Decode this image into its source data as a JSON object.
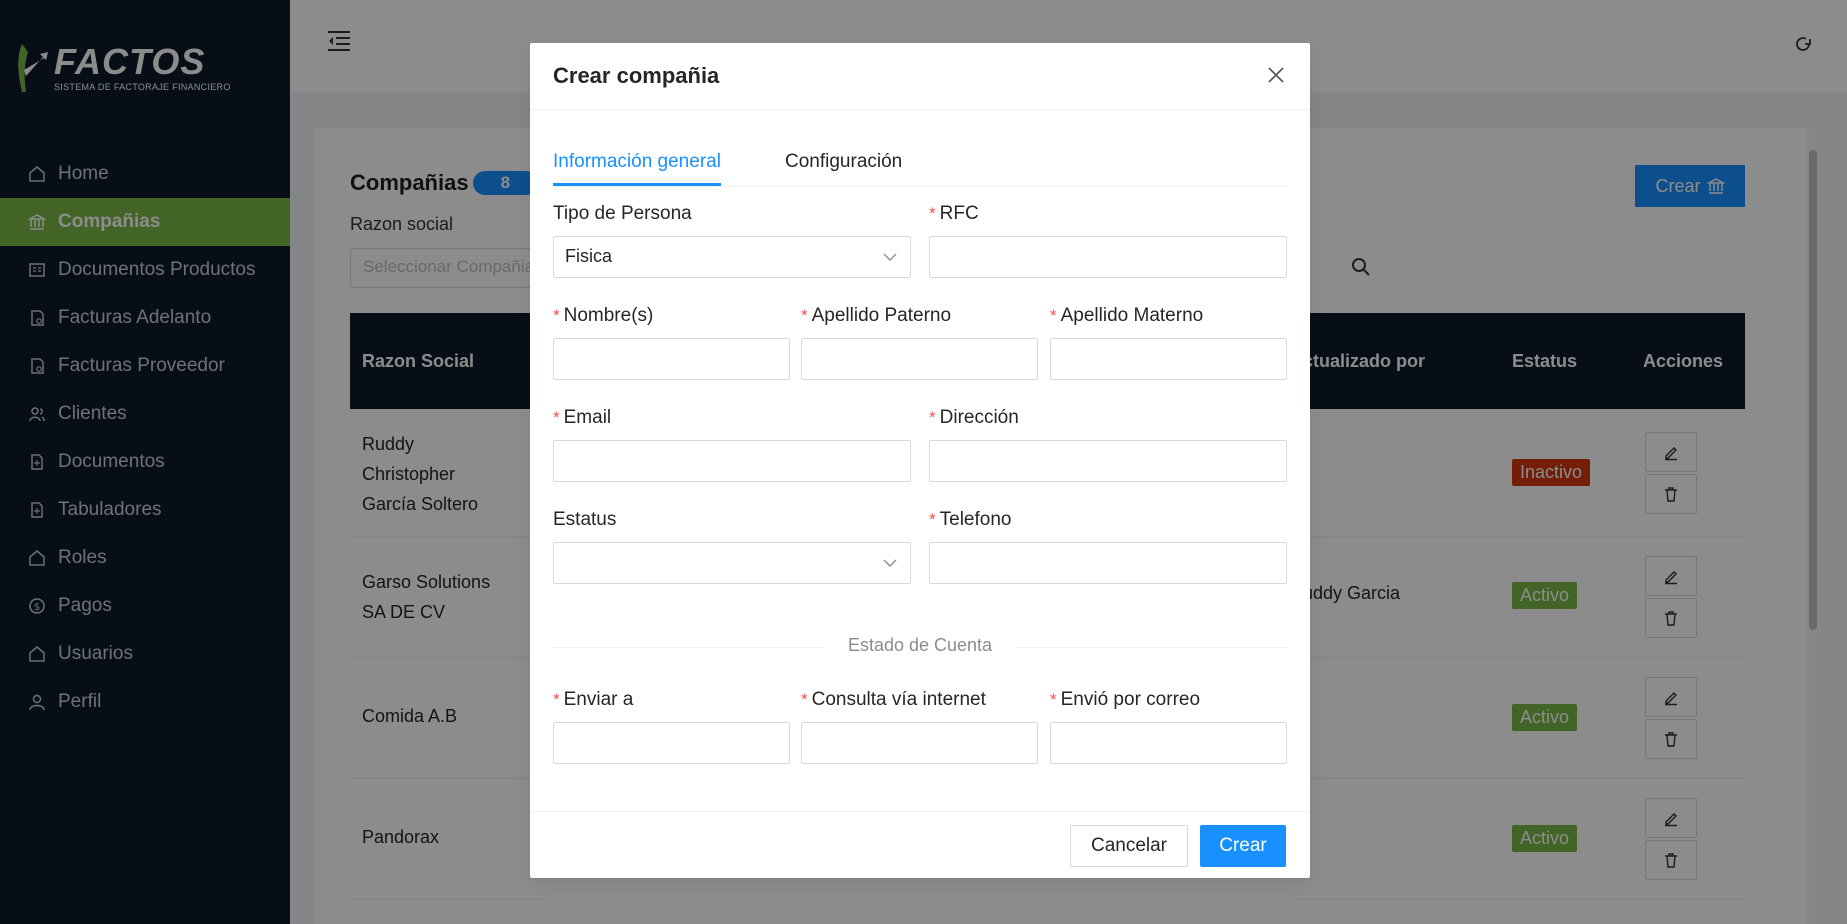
{
  "app": {
    "logo_title": "FACTOS",
    "logo_subtitle": "SISTEMA DE FACTORAJE FINANCIERO"
  },
  "sidebar": {
    "items": [
      {
        "label": "Home",
        "icon": "home-icon"
      },
      {
        "label": "Compañias",
        "icon": "bank-icon"
      },
      {
        "label": "Documentos Productos",
        "icon": "document-icon"
      },
      {
        "label": "Facturas Adelanto",
        "icon": "invoice-icon"
      },
      {
        "label": "Facturas Proveedor",
        "icon": "invoice-icon"
      },
      {
        "label": "Clientes",
        "icon": "users-icon"
      },
      {
        "label": "Documentos",
        "icon": "file-icon"
      },
      {
        "label": "Tabuladores",
        "icon": "file-icon"
      },
      {
        "label": "Roles",
        "icon": "home-icon"
      },
      {
        "label": "Pagos",
        "icon": "dollar-icon"
      },
      {
        "label": "Usuarios",
        "icon": "home-icon"
      },
      {
        "label": "Perfil",
        "icon": "user-icon"
      }
    ],
    "active_index": 1
  },
  "page": {
    "title": "Compañias",
    "count": "8",
    "filter_label": "Razon social",
    "filter_placeholder": "Seleccionar Compañia",
    "create_button": "Crear",
    "table": {
      "columns": [
        "Razon Social",
        "Actualizado por",
        "Estatus",
        "Acciones"
      ],
      "rows": [
        {
          "razon_social": [
            "Ruddy",
            "Christopher",
            "García Soltero"
          ],
          "actualizado_por": "",
          "estatus": "Inactivo"
        },
        {
          "razon_social": [
            "Garso Solutions",
            "SA DE CV"
          ],
          "actualizado_por": "Ruddy Garcia",
          "estatus": "Activo"
        },
        {
          "razon_social": [
            "Comida A.B"
          ],
          "actualizado_por": "",
          "estatus": "Activo"
        },
        {
          "razon_social": [
            "Pandorax"
          ],
          "actualizado_por": "",
          "estatus": "Activo"
        }
      ]
    }
  },
  "modal": {
    "title": "Crear compañia",
    "tabs": [
      "Información general",
      "Configuración"
    ],
    "active_tab": 0,
    "fields": {
      "tipo_persona": {
        "label": "Tipo de Persona",
        "value": "Fisica",
        "required": false
      },
      "rfc": {
        "label": "RFC",
        "value": "",
        "required": true
      },
      "nombre": {
        "label": "Nombre(s)",
        "value": "",
        "required": true
      },
      "apellido_paterno": {
        "label": "Apellido Paterno",
        "value": "",
        "required": true
      },
      "apellido_materno": {
        "label": "Apellido Materno",
        "value": "",
        "required": true
      },
      "email": {
        "label": "Email",
        "value": "",
        "required": true
      },
      "direccion": {
        "label": "Dirección",
        "value": "",
        "required": true
      },
      "estatus": {
        "label": "Estatus",
        "value": "",
        "required": false
      },
      "telefono": {
        "label": "Telefono",
        "value": "",
        "required": true
      },
      "enviar_a": {
        "label": "Enviar a",
        "value": "",
        "required": true
      },
      "consulta_internet": {
        "label": "Consulta vía internet",
        "value": "",
        "required": true
      },
      "envio_correo": {
        "label": "Envió por correo",
        "value": "",
        "required": true
      }
    },
    "section_divider": "Estado de Cuenta",
    "cancel_button": "Cancelar",
    "create_button": "Crear"
  },
  "colors": {
    "sidebar_bg": "#0e1a2b",
    "active_green": "#7ab648",
    "primary_blue": "#1890ff",
    "inactive_red": "#d4380d"
  }
}
